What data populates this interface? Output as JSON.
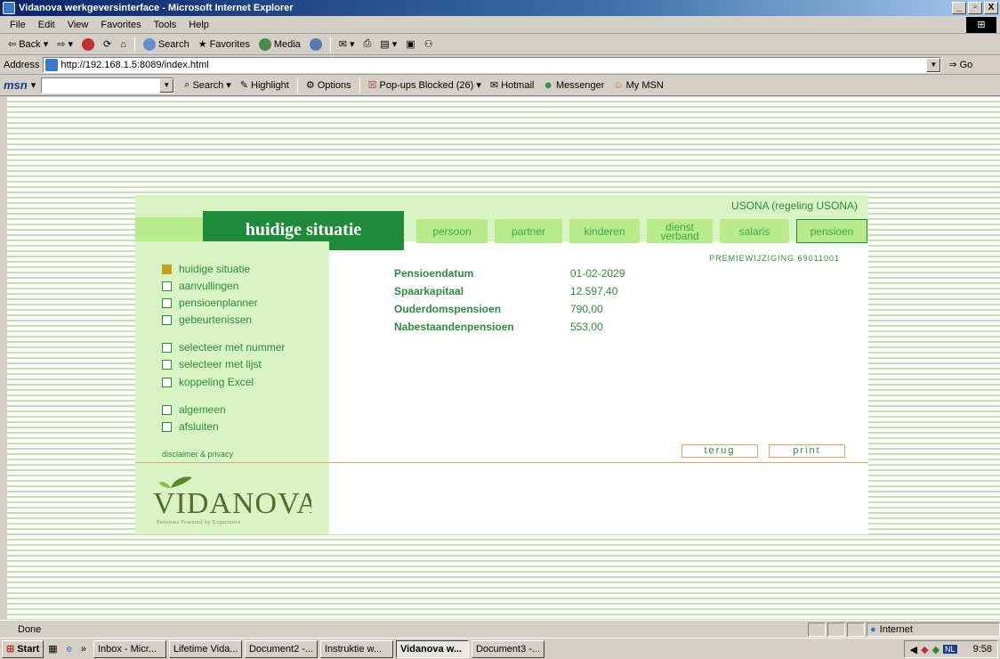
{
  "window": {
    "title": "Vidanova werkgeversinterface - Microsoft Internet Explorer",
    "buttons": [
      "_",
      "▫",
      "X"
    ]
  },
  "menu": [
    "File",
    "Edit",
    "View",
    "Favorites",
    "Tools",
    "Help"
  ],
  "toolbar": {
    "back": "Back",
    "search": "Search",
    "favorites": "Favorites",
    "media": "Media"
  },
  "address": {
    "label": "Address",
    "url": "http://192.168.1.5:8089/index.html",
    "go": "Go"
  },
  "msn": {
    "logo": "msn",
    "search": "Search",
    "highlight": "Highlight",
    "options": "Options",
    "popups": "Pop-ups Blocked (26)",
    "hotmail": "Hotmail",
    "messenger": "Messenger",
    "mymsn": "My MSN"
  },
  "app": {
    "scheme": "USONA (regeling USONA)",
    "page_title": "huidige situatie",
    "tabs": [
      {
        "label": "persoon"
      },
      {
        "label": "partner"
      },
      {
        "label": "kinderen"
      },
      {
        "label": "dienst verband"
      },
      {
        "label": "salaris"
      },
      {
        "label": "pensioen"
      }
    ],
    "premie": "PREMIEWIJZIGING 69011001",
    "fields": [
      {
        "label": "Pensioendatum",
        "value": "01-02-2029"
      },
      {
        "label": "Spaarkapitaal",
        "value": "12.597,40"
      },
      {
        "label": "Ouderdomspensioen",
        "value": "790,00"
      },
      {
        "label": "Nabestaandenpensioen",
        "value": "553,00"
      }
    ],
    "sidebar": [
      {
        "label": "huidige situatie"
      },
      {
        "label": "aanvullingen"
      },
      {
        "label": "pensioenplanner"
      },
      {
        "label": "gebeurtenissen"
      },
      {
        "label": "selecteer met nummer"
      },
      {
        "label": "selecteer met lijst"
      },
      {
        "label": "koppeling Excel"
      },
      {
        "label": "algemeen"
      },
      {
        "label": "afsluiten"
      }
    ],
    "disclaimer": "disclaimer & privacy",
    "back_button": "terug",
    "print_button": "print",
    "logo_text": "VIDANOVA",
    "logo_tagline": "Pensions Powered by Experience"
  },
  "status": {
    "text": "Done",
    "zone": "Internet"
  },
  "taskbar": {
    "start": "Start",
    "tasks": [
      "Inbox - Micr...",
      "Lifetime Vida...",
      "Document2 -...",
      "Instruktie w...",
      "Vidanova w...",
      "Document3 -..."
    ],
    "clock": "9:58",
    "lang": "NL"
  }
}
